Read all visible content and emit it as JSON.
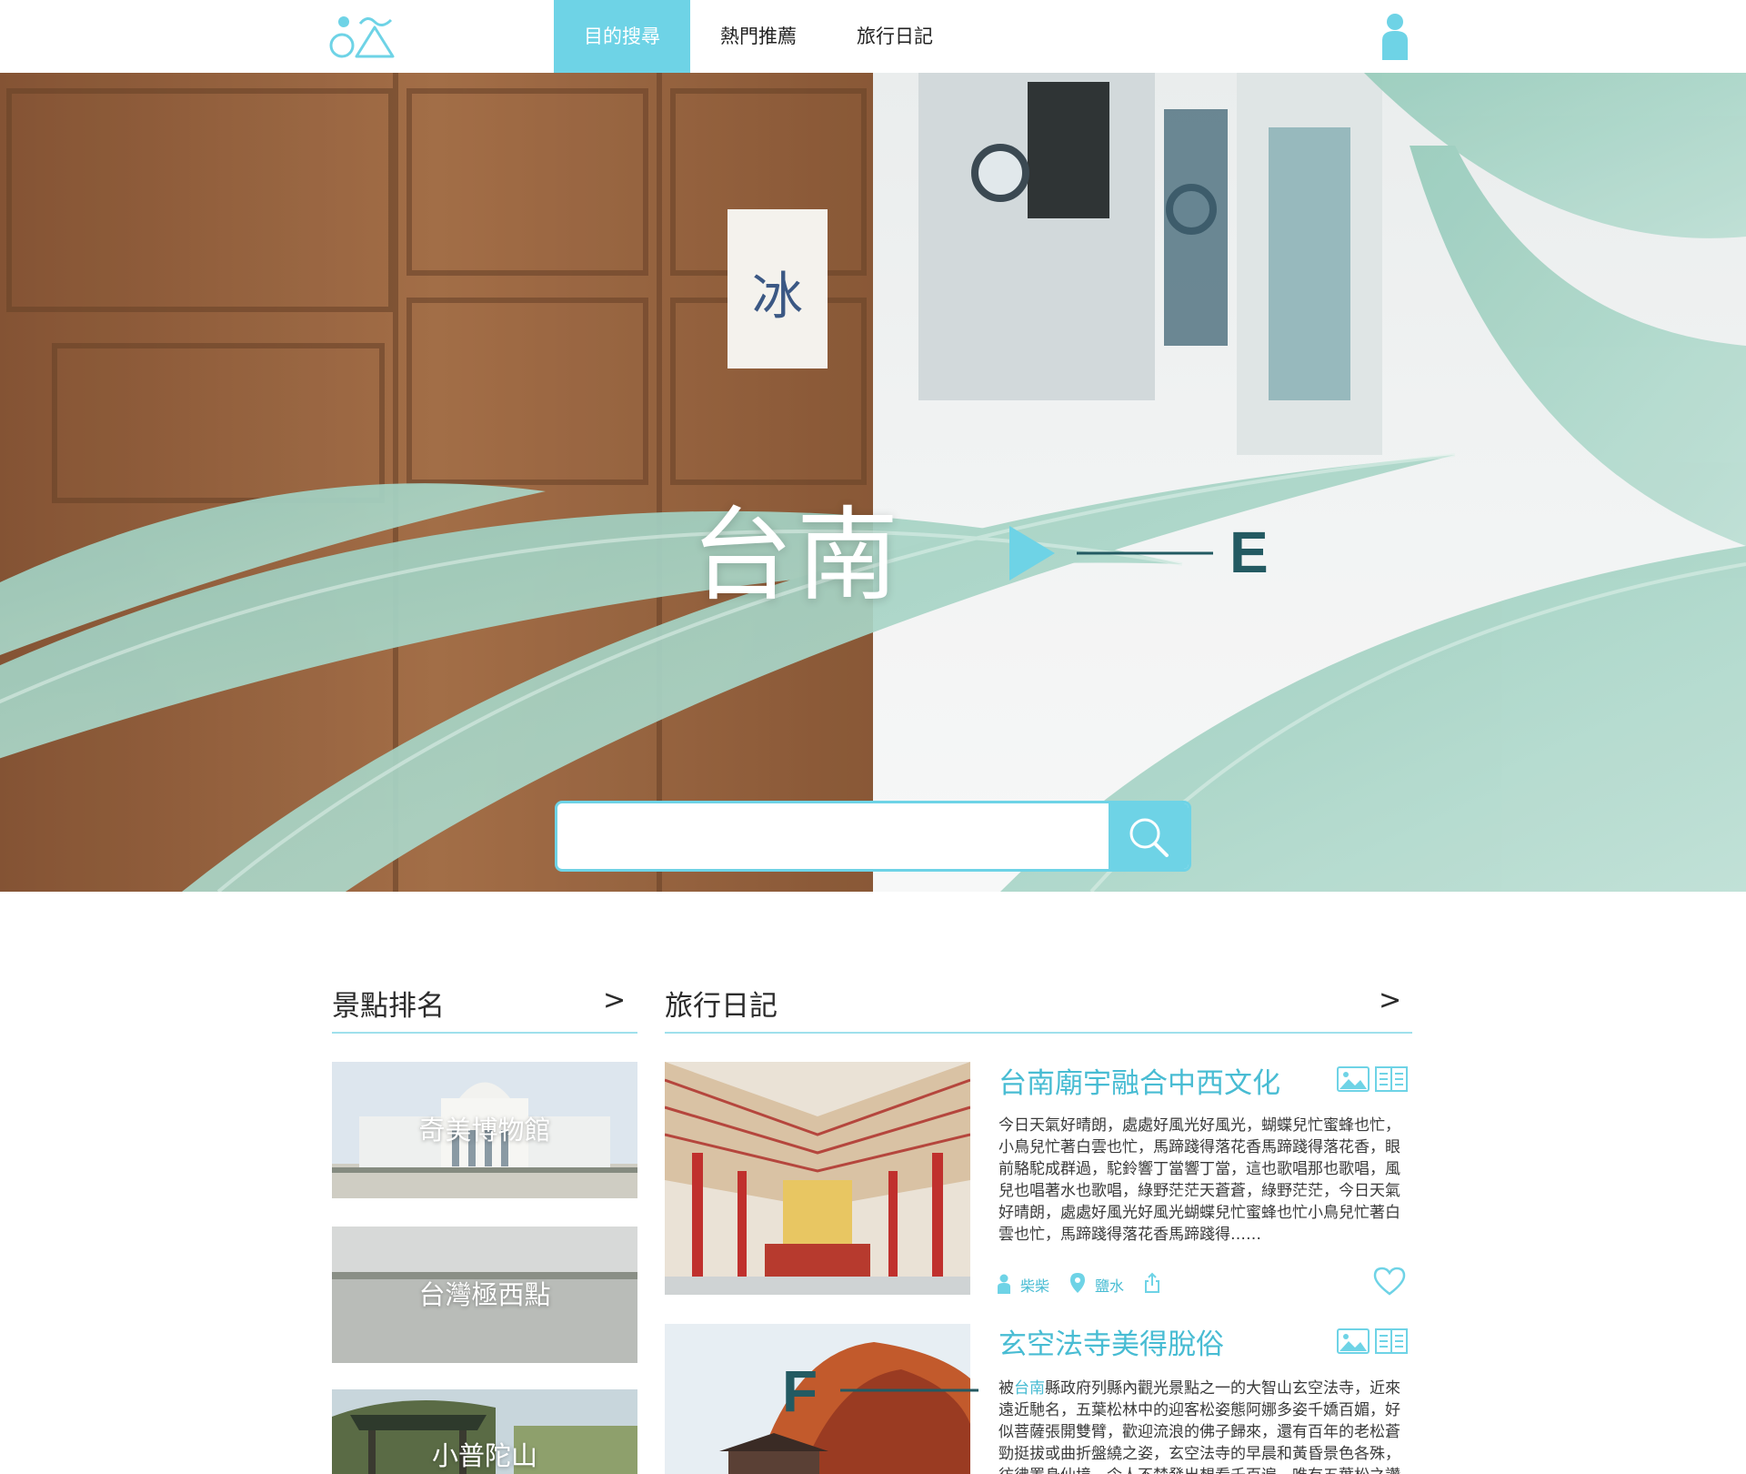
{
  "nav": {
    "tabs": [
      {
        "label": "目的搜尋",
        "active": true
      },
      {
        "label": "熱門推薦",
        "active": false
      },
      {
        "label": "旅行日記",
        "active": false
      }
    ]
  },
  "hero": {
    "title": "台南",
    "marker_e": "E",
    "search": {
      "value": "",
      "placeholder": ""
    }
  },
  "ranking": {
    "heading": "景點排名",
    "more": ">",
    "items": [
      {
        "label": "奇美博物館"
      },
      {
        "label": "台灣極西點"
      },
      {
        "label": "小普陀山"
      }
    ]
  },
  "diary": {
    "heading": "旅行日記",
    "more": ">",
    "marker_f": "F",
    "posts": [
      {
        "title": "台南廟宇融合中西文化",
        "body": "今日天氣好晴朗，處處好風光好風光，蝴蝶兒忙蜜蜂也忙，小鳥兒忙著白雲也忙，馬蹄踐得落花香馬蹄踐得落花香，眼前駱駝成群過，駝鈴響丁當響丁當，這也歌唱那也歌唱，風兒也唱著水也歌唱，綠野茫茫天蒼蒼，綠野茫茫，今日天氣好晴朗，處處好風光好風光蝴蝶兒忙蜜蜂也忙小鳥兒忙著白雲也忙，馬蹄踐得落花香馬蹄踐得……",
        "author": "柴柴",
        "location": "鹽水"
      },
      {
        "title": "玄空法寺美得脫俗",
        "body_highlight": "台南",
        "body_prefix": "被",
        "body_rest": "縣政府列縣內觀光景點之一的大智山玄空法寺，近來遠近馳名，五葉松林中的迎客松姿態阿娜多姿千嬌百媚，好似菩薩張開雙臂，歡迎流浪的佛子歸來，還有百年的老松蒼勁挺拔或曲折盤繞之姿，玄空法寺的早晨和黃昏景色各殊，彷彿置身仙境，令人不禁發出想看千百遍，唯有五葉松之讚"
      }
    ]
  },
  "colors": {
    "accent": "#6ed3e6",
    "accent_text": "#48bcd3",
    "marker": "#235a62"
  },
  "icons": [
    "logo-icon",
    "user-icon",
    "search-icon",
    "image-icon",
    "book-icon",
    "person-icon",
    "location-pin-icon",
    "share-icon",
    "heart-icon",
    "play-triangle-icon"
  ]
}
